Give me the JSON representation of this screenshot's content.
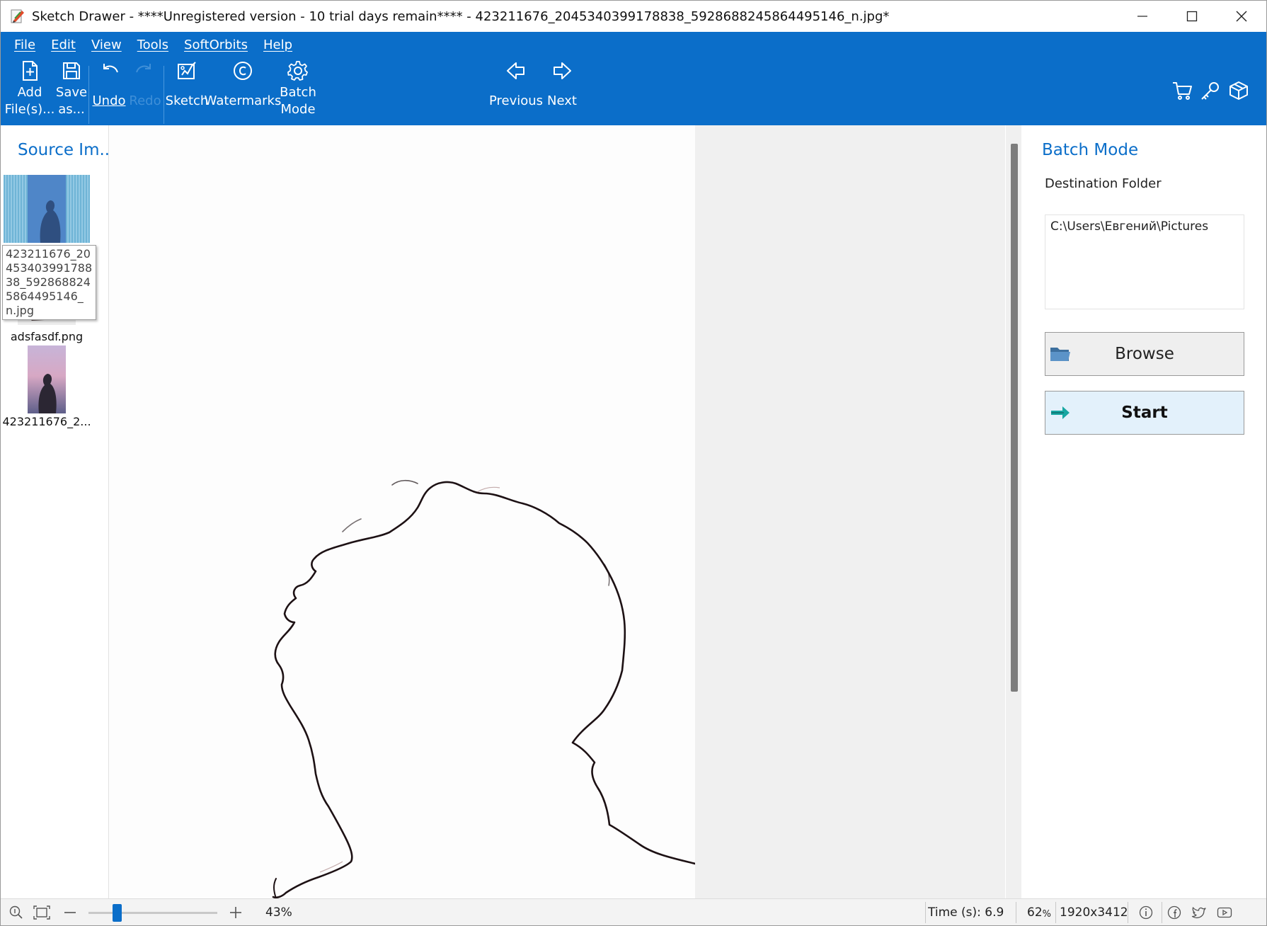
{
  "window": {
    "title": "Sketch Drawer - ****Unregistered version - 10 trial days remain**** - 423211676_2045340399178838_5928688245864495146_n.jpg*"
  },
  "menu": [
    "File",
    "Edit",
    "View",
    "Tools",
    "SoftOrbits",
    "Help"
  ],
  "toolbar": {
    "add_files": [
      "Add",
      "File(s)..."
    ],
    "save_as": [
      "Save",
      "as..."
    ],
    "undo": "Undo",
    "redo": "Redo",
    "sketch": "Sketch",
    "watermarks": "Watermarks",
    "batch_mode": [
      "Batch",
      "Mode"
    ],
    "previous": "Previous",
    "next": "Next"
  },
  "left_panel": {
    "title": "Source Im...",
    "tooltip": "423211676_2045340399178838_5928688245864495146_n.jpg",
    "thumb_labels": [
      "adsfasdf.png",
      "423211676_2..."
    ]
  },
  "right_panel": {
    "title": "Batch Mode",
    "destination_label": "Destination Folder",
    "destination_value": "C:\\Users\\Евгений\\Pictures",
    "browse_label": "Browse",
    "start_label": "Start"
  },
  "status": {
    "zoom": "43%",
    "zoom_fraction": 0.2,
    "time": "Time (s): 6.9",
    "percent_value": "62",
    "percent_sign": "%",
    "dimensions": "1920x3412"
  },
  "colors": {
    "accent": "#0b6ec9",
    "start_bg": "#e3f1fb",
    "browse_bg": "#efefef"
  },
  "icons": [
    "app-icon",
    "minimize-icon",
    "maximize-icon",
    "close-icon",
    "add-file-icon",
    "save-icon",
    "undo-icon",
    "redo-icon",
    "sketch-icon",
    "watermark-icon",
    "gear-icon",
    "previous-icon",
    "next-icon",
    "cart-icon",
    "key-icon",
    "box-icon",
    "folder-icon",
    "arrow-right-icon",
    "zoom-info-icon",
    "fit-icon",
    "zoom-out-icon",
    "zoom-in-icon",
    "info-icon",
    "facebook-icon",
    "twitter-icon",
    "youtube-icon"
  ]
}
